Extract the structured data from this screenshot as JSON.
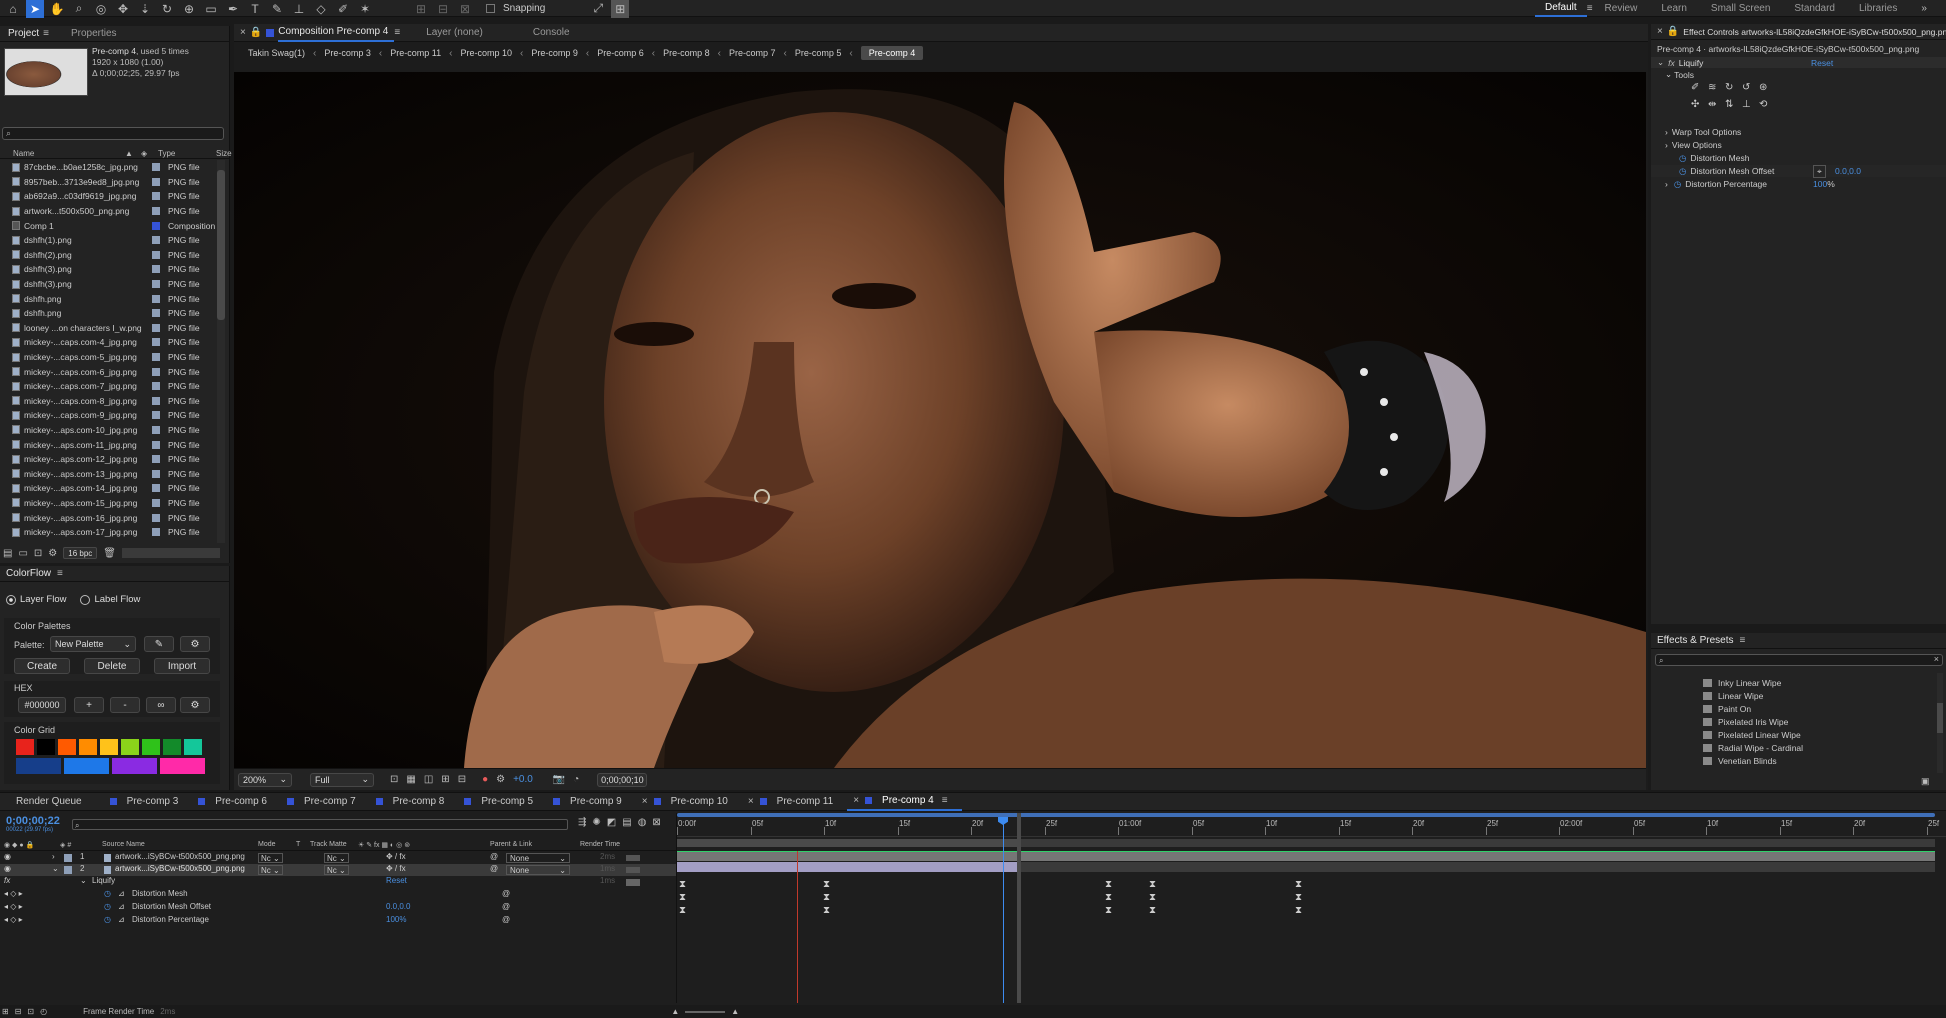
{
  "toolbar": {
    "snapping": "Snapping",
    "workspaces": [
      "Default",
      "Review",
      "Learn",
      "Small Screen",
      "Standard",
      "Libraries"
    ]
  },
  "project": {
    "tab": "Project",
    "tab2": "Properties",
    "comp_name": "Pre-comp 4",
    "comp_used": ", used 5 times",
    "comp_size": "1920 x 1080 (1.00)",
    "comp_duration": "Δ 0;00;02;25, 29.97 fps",
    "search_placeholder": "",
    "col_name": "Name",
    "col_type": "Type",
    "col_size": "Size",
    "items": [
      {
        "name": "87cbcbe...b0ae1258c_jpg.png",
        "type": "PNG file",
        "color": "#8e9fb8"
      },
      {
        "name": "8957beb...3713e9ed8_jpg.png",
        "type": "PNG file",
        "color": "#8e9fb8"
      },
      {
        "name": "ab692a9...c03df9619_jpg.png",
        "type": "PNG file",
        "color": "#8e9fb8"
      },
      {
        "name": "artwork...t500x500_png.png",
        "type": "PNG file",
        "color": "#8e9fb8"
      },
      {
        "name": "Comp 1",
        "type": "Composition",
        "color": "#3553d6"
      },
      {
        "name": "dshfh(1).png",
        "type": "PNG file",
        "color": "#8e9fb8"
      },
      {
        "name": "dshfh(2).png",
        "type": "PNG file",
        "color": "#8e9fb8"
      },
      {
        "name": "dshfh(3).png",
        "type": "PNG file",
        "color": "#8e9fb8"
      },
      {
        "name": "dshfh(3).png",
        "type": "PNG file",
        "color": "#8e9fb8"
      },
      {
        "name": "dshfh.png",
        "type": "PNG file",
        "color": "#8e9fb8"
      },
      {
        "name": "dshfh.png",
        "type": "PNG file",
        "color": "#8e9fb8"
      },
      {
        "name": "looney ...on characters I_w.png",
        "type": "PNG file",
        "color": "#8e9fb8"
      },
      {
        "name": "mickey-...caps.com-4_jpg.png",
        "type": "PNG file",
        "color": "#8e9fb8"
      },
      {
        "name": "mickey-...caps.com-5_jpg.png",
        "type": "PNG file",
        "color": "#8e9fb8"
      },
      {
        "name": "mickey-...caps.com-6_jpg.png",
        "type": "PNG file",
        "color": "#8e9fb8"
      },
      {
        "name": "mickey-...caps.com-7_jpg.png",
        "type": "PNG file",
        "color": "#8e9fb8"
      },
      {
        "name": "mickey-...caps.com-8_jpg.png",
        "type": "PNG file",
        "color": "#8e9fb8"
      },
      {
        "name": "mickey-...caps.com-9_jpg.png",
        "type": "PNG file",
        "color": "#8e9fb8"
      },
      {
        "name": "mickey-...aps.com-10_jpg.png",
        "type": "PNG file",
        "color": "#8e9fb8"
      },
      {
        "name": "mickey-...aps.com-11_jpg.png",
        "type": "PNG file",
        "color": "#8e9fb8"
      },
      {
        "name": "mickey-...aps.com-12_jpg.png",
        "type": "PNG file",
        "color": "#8e9fb8"
      },
      {
        "name": "mickey-...aps.com-13_jpg.png",
        "type": "PNG file",
        "color": "#8e9fb8"
      },
      {
        "name": "mickey-...aps.com-14_jpg.png",
        "type": "PNG file",
        "color": "#8e9fb8"
      },
      {
        "name": "mickey-...aps.com-15_jpg.png",
        "type": "PNG file",
        "color": "#8e9fb8"
      },
      {
        "name": "mickey-...aps.com-16_jpg.png",
        "type": "PNG file",
        "color": "#8e9fb8"
      },
      {
        "name": "mickey-...aps.com-17_jpg.png",
        "type": "PNG file",
        "color": "#8e9fb8"
      }
    ],
    "bpc": "16 bpc"
  },
  "colorflow": {
    "title": "ColorFlow",
    "layer_flow": "Layer Flow",
    "label_flow": "Label Flow",
    "palettes_title": "Color Palettes",
    "palette_label": "Palette:",
    "palette_value": "New Palette",
    "create": "Create",
    "delete": "Delete",
    "import": "Import",
    "hex_title": "HEX",
    "hex_value": "#000000",
    "plus": "+",
    "minus": "-",
    "grid_title": "Color Grid",
    "grid_row1": [
      "#e8231c",
      "#000000",
      "#ff5a00",
      "#ff8c00",
      "#ffc21a",
      "#8bd41a",
      "#2fc21a",
      "#138a2a",
      "#14c79a"
    ],
    "grid_row2": [
      "#163e8a",
      "#1e78e8",
      "#8a2be2",
      "#ff2aa8"
    ]
  },
  "composition": {
    "tab": "Composition Pre-comp 4",
    "layer_tab": "Layer (none)",
    "console_tab": "Console",
    "crumbs": [
      "Takin Swag(1)",
      "Pre-comp 3",
      "Pre-comp 11",
      "Pre-comp 10",
      "Pre-comp 9",
      "Pre-comp 6",
      "Pre-comp 8",
      "Pre-comp 7",
      "Pre-comp 5",
      "Pre-comp 4"
    ],
    "zoom": "200%",
    "resolution": "Full",
    "exposure": "+0.0",
    "timecode": "0;00;00;10"
  },
  "effects": {
    "tab": "Effect Controls artworks-lL58iQzdeGfkHOE-iSyBCw-t500x500_png.png",
    "layer_path": "Pre-comp 4 · artworks-lL58iQzdeGfkHOE-iSyBCw-t500x500_png.png",
    "effect_name": "Liquify",
    "reset": "Reset",
    "tools": "Tools",
    "warp": "Warp Tool Options",
    "view": "View Options",
    "distortion_mesh": "Distortion Mesh",
    "distortion_mesh_offset": "Distortion Mesh Offset",
    "offset_value": "0.0,0.0",
    "distortion_pct": "Distortion Percentage",
    "pct_value": "100",
    "pct_unit": "%"
  },
  "presets": {
    "title": "Effects & Presets",
    "search_placeholder": "",
    "items": [
      "Inky Linear Wipe",
      "Linear Wipe",
      "Paint On",
      "Pixelated Iris Wipe",
      "Pixelated Linear Wipe",
      "Radial Wipe - Cardinal",
      "Venetian Blinds"
    ]
  },
  "timeline": {
    "render_queue": "Render Queue",
    "tabs": [
      "Pre-comp 3",
      "Pre-comp 6",
      "Pre-comp 7",
      "Pre-comp 8",
      "Pre-comp 5",
      "Pre-comp 9",
      "Pre-comp 10",
      "Pre-comp 11",
      "Pre-comp 4"
    ],
    "timecode": "0;00;00;22",
    "fps": "00022 (29.97 fps)",
    "col_source": "Source Name",
    "col_mode": "Mode",
    "col_t": "T",
    "col_track": "Track Matte",
    "col_parent": "Parent & Link",
    "col_render": "Render Time",
    "layers": [
      {
        "num": "1",
        "name": "artwork...iSyBCw-t500x500_png.png",
        "mode": "Nc",
        "matte": "Nc",
        "parent": "None",
        "render": "2ms",
        "color": "#8e9fb8"
      },
      {
        "num": "2",
        "name": "artwork...iSyBCw-t500x500_png.png",
        "mode": "Nc",
        "matte": "Nc",
        "parent": "None",
        "render": "1ms",
        "color": "#8e9fb8"
      }
    ],
    "fx_name": "Liquify",
    "fx_reset": "Reset",
    "fx_render": "1ms",
    "props": [
      {
        "name": "Distortion Mesh",
        "value": ""
      },
      {
        "name": "Distortion Mesh Offset",
        "value": "0.0,0.0"
      },
      {
        "name": "Distortion Percentage",
        "value": "100%"
      }
    ],
    "ruler": [
      "0:00f",
      "05f",
      "10f",
      "15f",
      "20f",
      "25f",
      "01:00f",
      "05f",
      "10f",
      "15f",
      "20f",
      "25f",
      "02:00f",
      "05f",
      "10f",
      "15f",
      "20f",
      "25f"
    ],
    "frame_render": "Frame Render Time",
    "frame_render_value": "2ms"
  }
}
